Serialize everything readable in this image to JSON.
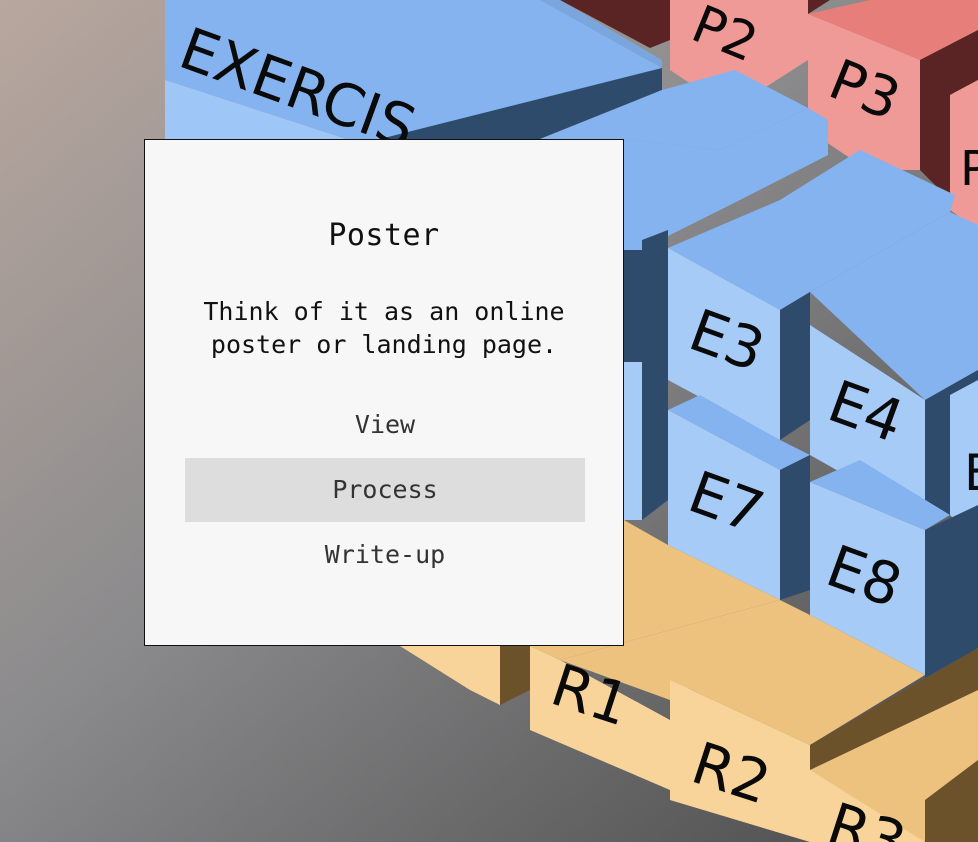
{
  "background": {
    "blocks": {
      "exercise_label": "EXERCIS",
      "p2": "P2",
      "p3": "P3",
      "p_partial": "P",
      "e_partial": "E",
      "e3": "E3",
      "e4": "E4",
      "e7": "E7",
      "e8": "E8",
      "r1": "R1",
      "r2": "R2",
      "r_partial": "R3"
    }
  },
  "card": {
    "title": "Poster",
    "description_line1": "Think of it as an online",
    "description_line2": "poster or landing page.",
    "menu": [
      {
        "label": "View",
        "active": false
      },
      {
        "label": "Process",
        "active": true
      },
      {
        "label": "Write-up",
        "active": false
      }
    ]
  },
  "colors": {
    "blue_top": "#85b3ef",
    "blue_front": "#a6cbf7",
    "blue_side": "#2e4b6c",
    "red_top": "#e87e7a",
    "red_front": "#f09a97",
    "red_side": "#5a2424",
    "orange_top": "#ecc27e",
    "orange_front": "#f8d49a",
    "orange_side": "#6b522b"
  }
}
